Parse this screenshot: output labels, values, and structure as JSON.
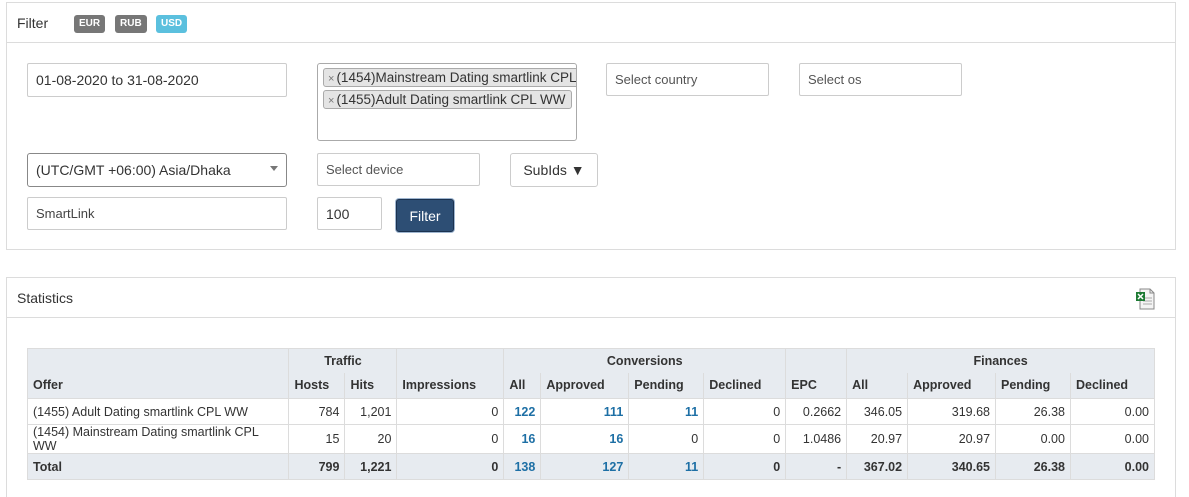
{
  "filter": {
    "title": "Filter",
    "currencies": [
      "EUR",
      "RUB",
      "USD"
    ],
    "date_range": "01-08-2020 to 31-08-2020",
    "offers_selected": [
      "(1454)Mainstream Dating smartlink CPL",
      "(1455)Adult Dating smartlink CPL WW"
    ],
    "chip_remove": "×",
    "country_placeholder": "Select country",
    "os_placeholder": "Select os",
    "timezone": "(UTC/GMT +06:00) Asia/Dhaka",
    "device_placeholder": "Select device",
    "subids_label": "SubIds ▼",
    "type_value": "SmartLink",
    "limit_value": "100",
    "filter_button": "Filter"
  },
  "statistics": {
    "title": "Statistics",
    "export_icon": "excel-export-icon",
    "groups": {
      "traffic": "Traffic",
      "conversions": "Conversions",
      "finances": "Finances"
    },
    "columns": {
      "offer": "Offer",
      "hosts": "Hosts",
      "hits": "Hits",
      "impressions": "Impressions",
      "conv_all": "All",
      "conv_approved": "Approved",
      "conv_pending": "Pending",
      "conv_declined": "Declined",
      "epc": "EPC",
      "fin_all": "All",
      "fin_approved": "Approved",
      "fin_pending": "Pending",
      "fin_declined": "Declined"
    },
    "rows": [
      {
        "offer": "(1455) Adult Dating smartlink CPL WW",
        "hosts": "784",
        "hits": "1,201",
        "impressions": "0",
        "conv_all": "122",
        "conv_approved": "111",
        "conv_pending": "11",
        "conv_declined": "0",
        "epc": "0.2662",
        "fin_all": "346.05",
        "fin_approved": "319.68",
        "fin_pending": "26.38",
        "fin_declined": "0.00"
      },
      {
        "offer": "(1454) Mainstream Dating smartlink CPL WW",
        "hosts": "15",
        "hits": "20",
        "impressions": "0",
        "conv_all": "16",
        "conv_approved": "16",
        "conv_pending": "0",
        "conv_declined": "0",
        "epc": "1.0486",
        "fin_all": "20.97",
        "fin_approved": "20.97",
        "fin_pending": "0.00",
        "fin_declined": "0.00"
      }
    ],
    "total": {
      "label": "Total",
      "hosts": "799",
      "hits": "1,221",
      "impressions": "0",
      "conv_all": "138",
      "conv_approved": "127",
      "conv_pending": "11",
      "conv_declined": "0",
      "epc": "-",
      "fin_all": "367.02",
      "fin_approved": "340.65",
      "fin_pending": "26.38",
      "fin_declined": "0.00"
    }
  }
}
